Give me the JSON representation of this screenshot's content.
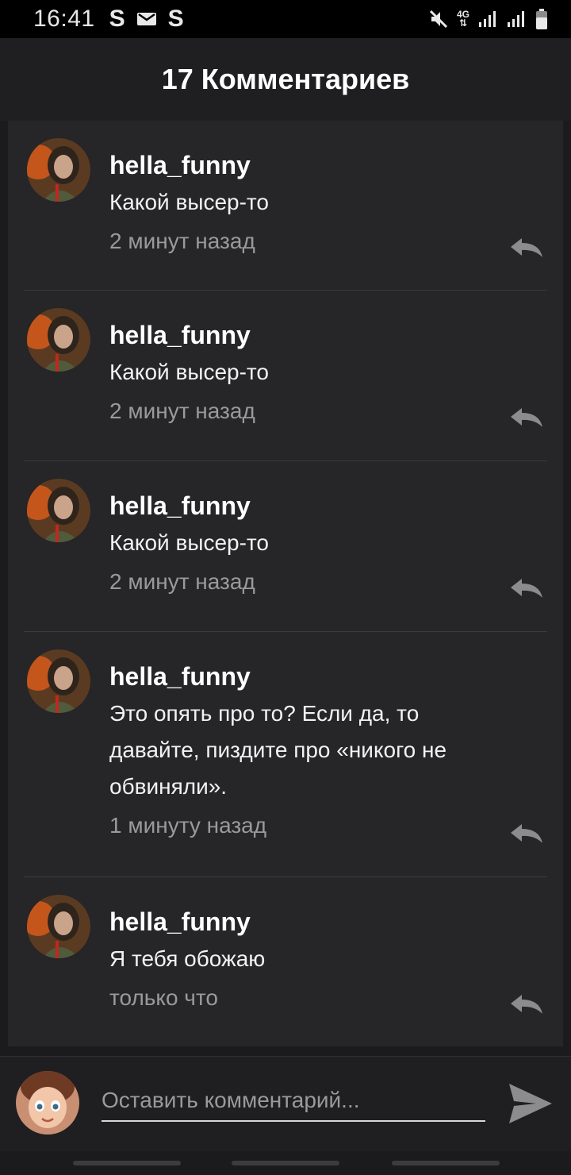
{
  "status_bar": {
    "time": "16:41",
    "notifications": [
      "S",
      "mail-icon",
      "S"
    ],
    "network": "4G"
  },
  "header": {
    "title": "17 Комментариев"
  },
  "comments": [
    {
      "username": "hella_funny",
      "text": "Какой высер-то",
      "time": "2 минут назад"
    },
    {
      "username": "hella_funny",
      "text": "Какой высер-то",
      "time": "2 минут назад"
    },
    {
      "username": "hella_funny",
      "text": "Какой высер-то",
      "time": "2 минут назад"
    },
    {
      "username": "hella_funny",
      "text_lines": [
        "Это опять про то? Если да, то",
        "давайте, пиздите про «никого не",
        "обвиняли»."
      ],
      "time": "1 минуту назад"
    },
    {
      "username": "hella_funny",
      "text": "Я тебя обожаю",
      "time": "только что"
    }
  ],
  "compose": {
    "placeholder": "Оставить комментарий..."
  },
  "colors": {
    "background": "#1b1a1c",
    "card": "#262528",
    "secondary_text": "#9a999c"
  }
}
